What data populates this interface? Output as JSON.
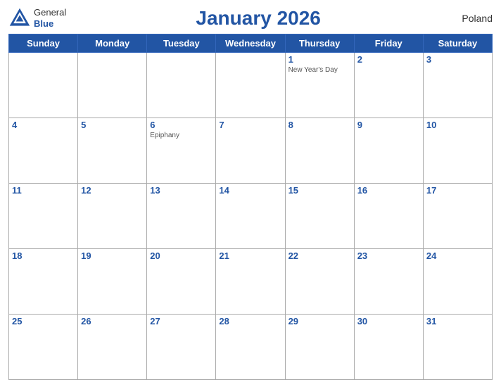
{
  "header": {
    "title": "January 2026",
    "country": "Poland",
    "logo_general": "General",
    "logo_blue": "Blue"
  },
  "days_of_week": [
    "Sunday",
    "Monday",
    "Tuesday",
    "Wednesday",
    "Thursday",
    "Friday",
    "Saturday"
  ],
  "weeks": [
    [
      {
        "num": "",
        "holiday": ""
      },
      {
        "num": "",
        "holiday": ""
      },
      {
        "num": "",
        "holiday": ""
      },
      {
        "num": "",
        "holiday": ""
      },
      {
        "num": "1",
        "holiday": "New Year's Day"
      },
      {
        "num": "2",
        "holiday": ""
      },
      {
        "num": "3",
        "holiday": ""
      }
    ],
    [
      {
        "num": "4",
        "holiday": ""
      },
      {
        "num": "5",
        "holiday": ""
      },
      {
        "num": "6",
        "holiday": "Epiphany"
      },
      {
        "num": "7",
        "holiday": ""
      },
      {
        "num": "8",
        "holiday": ""
      },
      {
        "num": "9",
        "holiday": ""
      },
      {
        "num": "10",
        "holiday": ""
      }
    ],
    [
      {
        "num": "11",
        "holiday": ""
      },
      {
        "num": "12",
        "holiday": ""
      },
      {
        "num": "13",
        "holiday": ""
      },
      {
        "num": "14",
        "holiday": ""
      },
      {
        "num": "15",
        "holiday": ""
      },
      {
        "num": "16",
        "holiday": ""
      },
      {
        "num": "17",
        "holiday": ""
      }
    ],
    [
      {
        "num": "18",
        "holiday": ""
      },
      {
        "num": "19",
        "holiday": ""
      },
      {
        "num": "20",
        "holiday": ""
      },
      {
        "num": "21",
        "holiday": ""
      },
      {
        "num": "22",
        "holiday": ""
      },
      {
        "num": "23",
        "holiday": ""
      },
      {
        "num": "24",
        "holiday": ""
      }
    ],
    [
      {
        "num": "25",
        "holiday": ""
      },
      {
        "num": "26",
        "holiday": ""
      },
      {
        "num": "27",
        "holiday": ""
      },
      {
        "num": "28",
        "holiday": ""
      },
      {
        "num": "29",
        "holiday": ""
      },
      {
        "num": "30",
        "holiday": ""
      },
      {
        "num": "31",
        "holiday": ""
      }
    ]
  ]
}
